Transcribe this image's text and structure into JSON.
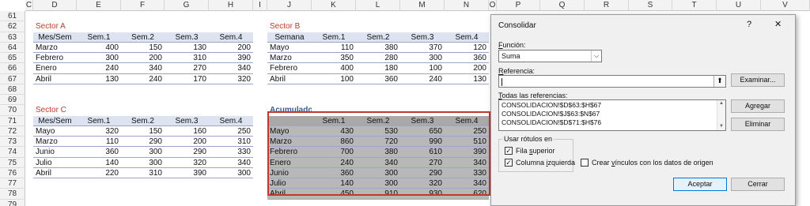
{
  "columns": [
    "C",
    "D",
    "E",
    "F",
    "G",
    "H",
    "I",
    "J",
    "K",
    "L",
    "M",
    "N",
    "O",
    "P",
    "Q",
    "R",
    "S",
    "T",
    "U",
    "V"
  ],
  "rows": [
    "61",
    "62",
    "63",
    "64",
    "65",
    "66",
    "67",
    "68",
    "69",
    "70",
    "71",
    "72",
    "73",
    "74",
    "75",
    "76",
    "77",
    "78",
    "79"
  ],
  "sectorA": {
    "title": "Sector A",
    "headers": [
      "Mes/Sem",
      "Sem.1",
      "Sem.2",
      "Sem.3",
      "Sem.4"
    ],
    "rows": [
      [
        "Marzo",
        "400",
        "150",
        "130",
        "200"
      ],
      [
        "Febrero",
        "300",
        "200",
        "310",
        "390"
      ],
      [
        "Enero",
        "240",
        "340",
        "270",
        "340"
      ],
      [
        "Abril",
        "130",
        "240",
        "170",
        "320"
      ]
    ]
  },
  "sectorB": {
    "title": "Sector B",
    "headers": [
      "Semana",
      "Sem.1",
      "Sem.2",
      "Sem.3",
      "Sem.4"
    ],
    "rows": [
      [
        "Mayo",
        "110",
        "380",
        "370",
        "120"
      ],
      [
        "Marzo",
        "350",
        "280",
        "300",
        "360"
      ],
      [
        "Febrero",
        "400",
        "180",
        "100",
        "200"
      ],
      [
        "Abril",
        "100",
        "360",
        "240",
        "130"
      ]
    ]
  },
  "sectorC": {
    "title": "Sector C",
    "headers": [
      "Mes/Sem",
      "Sem.1",
      "Sem.2",
      "Sem.3",
      "Sem.4"
    ],
    "rows": [
      [
        "Mayo",
        "320",
        "150",
        "160",
        "250"
      ],
      [
        "Marzo",
        "110",
        "290",
        "200",
        "310"
      ],
      [
        "Junio",
        "360",
        "300",
        "290",
        "330"
      ],
      [
        "Julio",
        "140",
        "300",
        "320",
        "340"
      ],
      [
        "Abril",
        "220",
        "310",
        "390",
        "300"
      ]
    ]
  },
  "acumulado": {
    "title": "Acumulado",
    "headers": [
      "",
      "Sem.1",
      "Sem.2",
      "Sem.3",
      "Sem.4"
    ],
    "rows": [
      [
        "Mayo",
        "430",
        "530",
        "650",
        "250"
      ],
      [
        "Marzo",
        "860",
        "720",
        "990",
        "510"
      ],
      [
        "Febrero",
        "700",
        "380",
        "610",
        "390"
      ],
      [
        "Enero",
        "240",
        "340",
        "270",
        "340"
      ],
      [
        "Junio",
        "360",
        "300",
        "290",
        "330"
      ],
      [
        "Julio",
        "140",
        "300",
        "320",
        "340"
      ],
      [
        "Abril",
        "450",
        "910",
        "930",
        "620"
      ]
    ]
  },
  "dialog": {
    "title": "Consolidar",
    "help": "?",
    "close": "✕",
    "funcion_label_u": "F",
    "funcion_label_rest": "unción:",
    "funcion_value": "Suma",
    "referencia_label_u": "R",
    "referencia_label_rest": "eferencia:",
    "referencia_value": "",
    "examinar": "Examinar...",
    "todas_label_u": "T",
    "todas_label_rest": "odas las referencias:",
    "references": [
      "CONSOLIDACION!$D$63:$H$67",
      "CONSOLIDACION!$J$63:$N$67",
      "CONSOLIDACION!$D$71:$H$76"
    ],
    "agregar": "Agregar",
    "eliminar": "Eliminar",
    "usar_rotulos": "Usar rótulos en",
    "fila_superior_pre": "Fila ",
    "fila_superior_u": "s",
    "fila_superior_post": "uperior",
    "columna_izq_pre": "Columna ",
    "columna_izq_u": "i",
    "columna_izq_post": "zquierda",
    "crear_vinculos_pre": "Crear ",
    "crear_vinculos_u": "v",
    "crear_vinculos_post": "ínculos con los datos de origen",
    "aceptar": "Aceptar",
    "cerrar": "Cerrar",
    "fila_superior_checked": true,
    "columna_izq_checked": true,
    "crear_vinculos_checked": false
  }
}
